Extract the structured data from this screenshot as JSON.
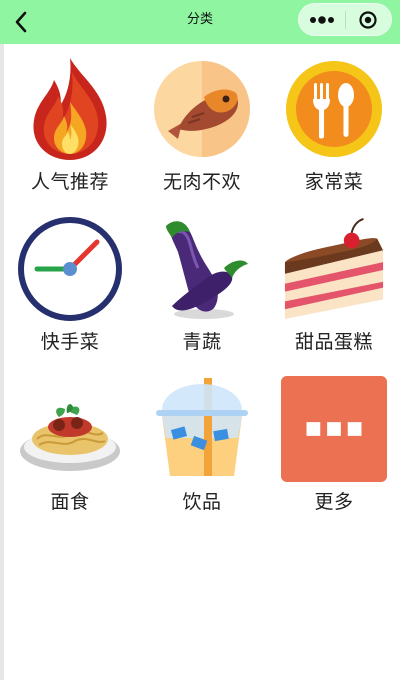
{
  "nav": {
    "title": "分类",
    "back_icon": "chevron-left-icon",
    "more_icon": "more-dots-icon",
    "close_icon": "target-circle-icon",
    "bg_color": "#8ff5a0"
  },
  "categories": [
    {
      "label": "人气推荐",
      "icon": "flame-icon"
    },
    {
      "label": "无肉不欢",
      "icon": "fish-icon"
    },
    {
      "label": "家常菜",
      "icon": "fork-spoon-icon"
    },
    {
      "label": "快手菜",
      "icon": "clock-icon"
    },
    {
      "label": "青蔬",
      "icon": "eggplant-icon"
    },
    {
      "label": "甜品蛋糕",
      "icon": "cake-slice-icon"
    },
    {
      "label": "面食",
      "icon": "spaghetti-icon"
    },
    {
      "label": "饮品",
      "icon": "drink-cup-icon"
    },
    {
      "label": "更多",
      "icon": "more-tile-icon"
    }
  ]
}
